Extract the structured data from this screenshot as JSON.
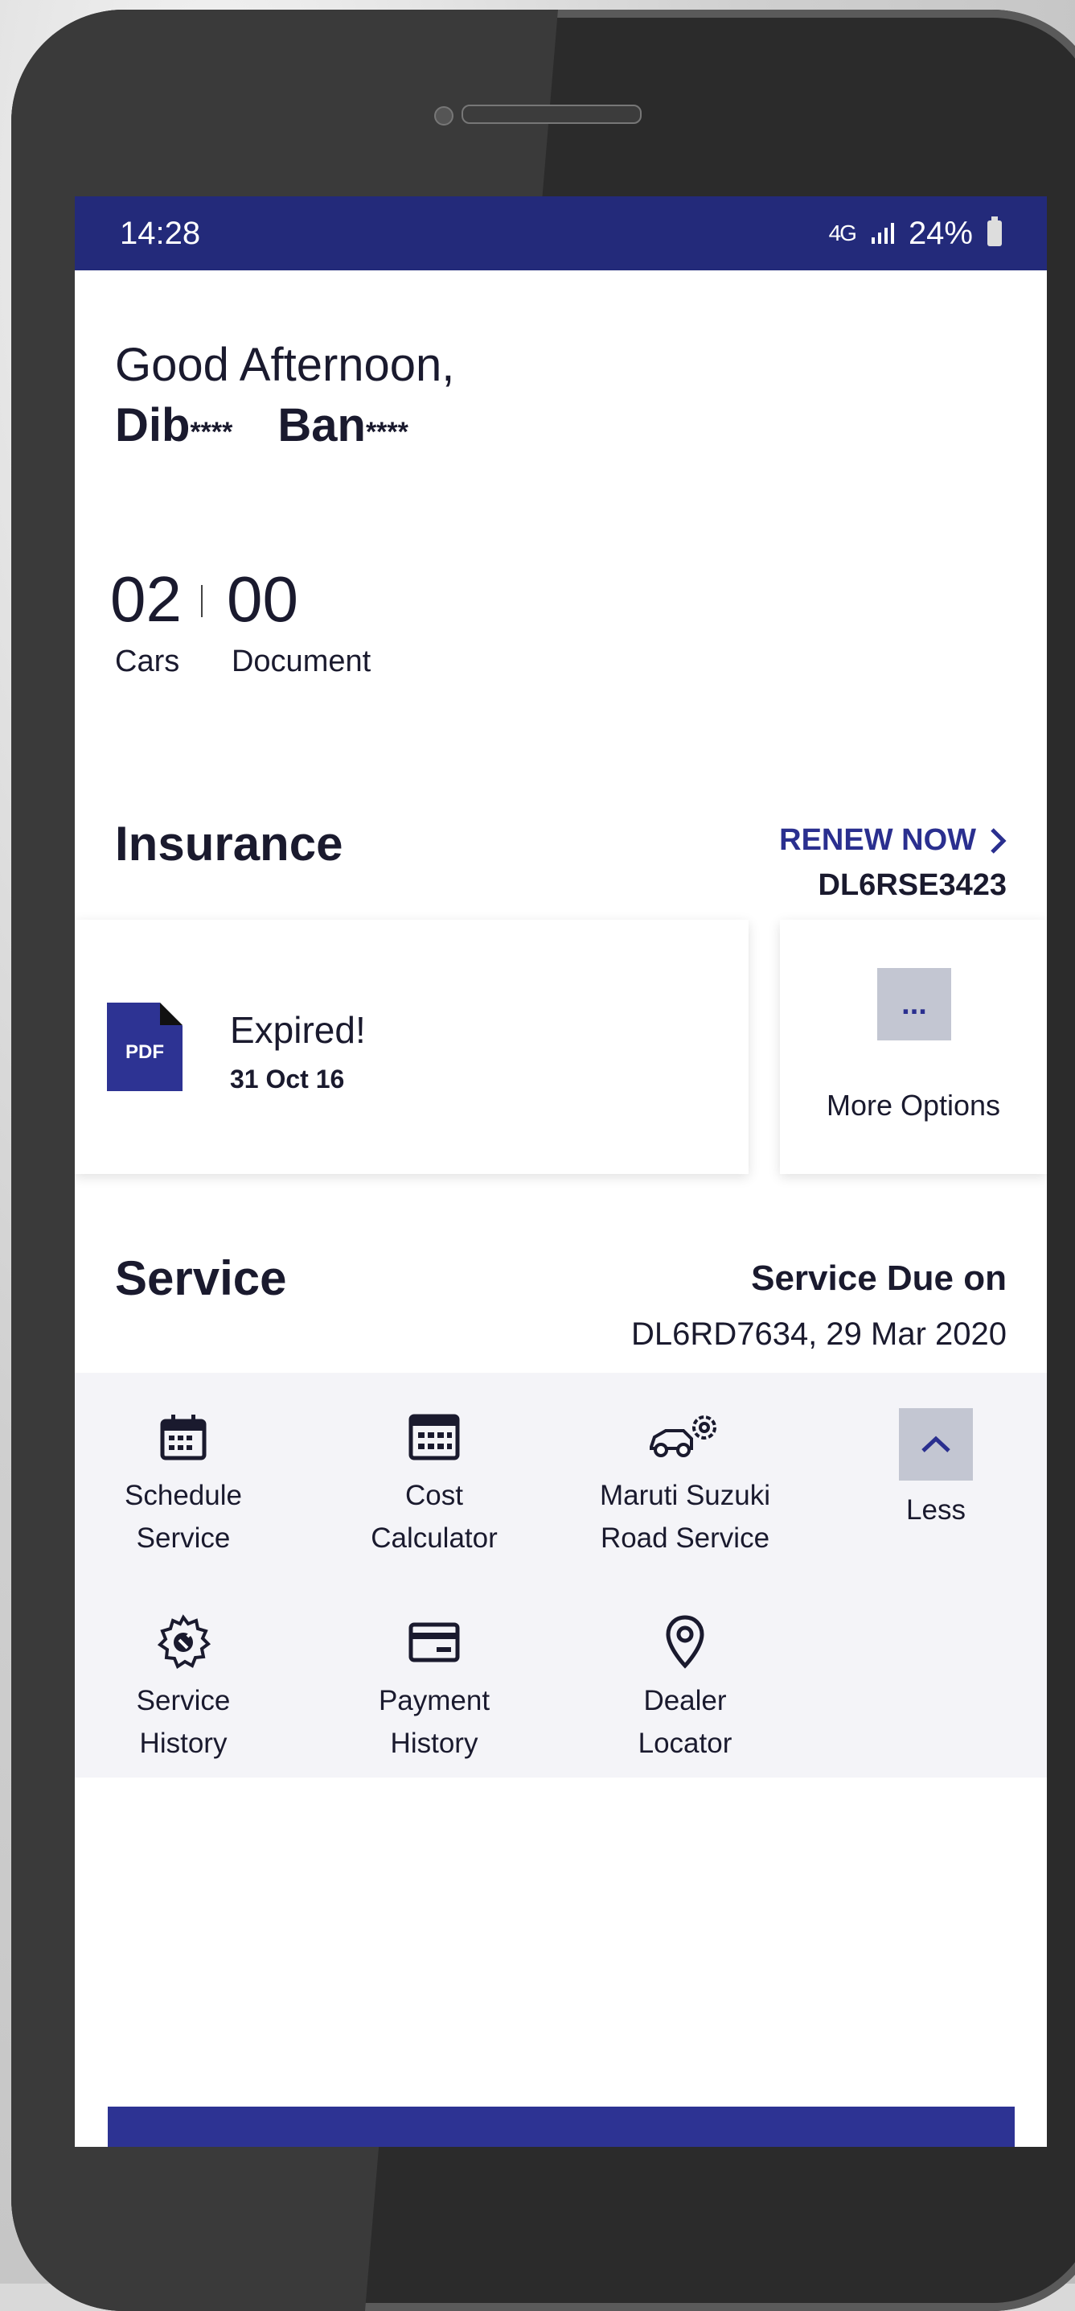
{
  "status_bar": {
    "time": "14:28",
    "network": "4G",
    "battery": "24%"
  },
  "greeting": {
    "line1": "Good Afternoon,",
    "first_name": "Dib",
    "first_mask": "****",
    "last_name": "Ban",
    "last_mask": "****"
  },
  "stats": [
    {
      "value": "02",
      "label": "Cars"
    },
    {
      "value": "00",
      "label": "Document"
    }
  ],
  "insurance": {
    "title": "Insurance",
    "renew_label": "RENEW NOW",
    "registration": "DL6RSE3423",
    "card": {
      "pdf_label": "PDF",
      "status": "Expired!",
      "date": "31 Oct 16"
    },
    "more": {
      "dots": "...",
      "label": "More Options"
    }
  },
  "service": {
    "title": "Service",
    "due_label": "Service Due on",
    "due_value": "DL6RD7634, 29 Mar 2020",
    "items": [
      {
        "line1": "Schedule",
        "line2": "Service",
        "icon": "calendar-icon"
      },
      {
        "line1": "Cost",
        "line2": "Calculator",
        "icon": "calculator-icon"
      },
      {
        "line1": "Maruti Suzuki",
        "line2": "Road Service",
        "icon": "car-gear-icon"
      },
      {
        "line1": "",
        "line2": "Less",
        "icon": "chevron-up-icon"
      },
      {
        "line1": "Service",
        "line2": "History",
        "icon": "gear-icon"
      },
      {
        "line1": "Payment",
        "line2": "History",
        "icon": "card-icon"
      },
      {
        "line1": "Dealer",
        "line2": "Locator",
        "icon": "location-pin-icon"
      }
    ]
  },
  "colors": {
    "primary": "#232a7a",
    "accent": "#2d3393",
    "panel": "#f4f4f8",
    "text": "#1a1a2e"
  }
}
